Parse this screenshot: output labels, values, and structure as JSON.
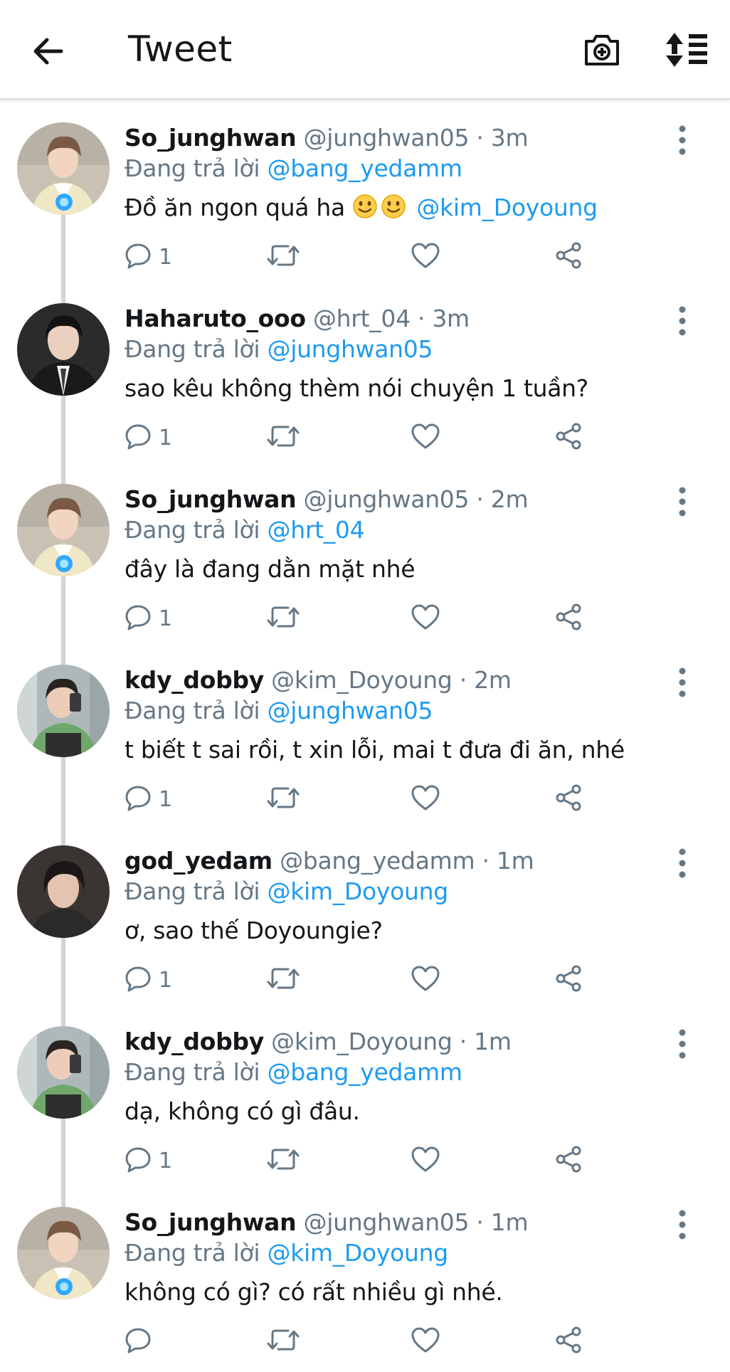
{
  "header": {
    "title": "Tweet"
  },
  "tweets": [
    {
      "name": "So_junghwan",
      "handle": "@junghwan05 · 3m",
      "reply_prefix": "Đang trả lời",
      "reply_to": "@bang_yedamm",
      "text": "Đồ ăn ngon quá ha",
      "mention": "@kim_Doyoung",
      "reply_count": "1",
      "avatar": "junghwan"
    },
    {
      "name": "Haharuto_ooo",
      "handle": "@hrt_04 · 3m",
      "reply_prefix": "Đang trả lời",
      "reply_to": "@junghwan05",
      "text": "sao kêu không thèm nói chuyện 1 tuần?",
      "mention": "",
      "reply_count": "1",
      "avatar": "haruto"
    },
    {
      "name": "So_junghwan",
      "handle": "@junghwan05 · 2m",
      "reply_prefix": "Đang trả lời",
      "reply_to": "@hrt_04",
      "text": "đây là đang dằn mặt nhé",
      "mention": "",
      "reply_count": "1",
      "avatar": "junghwan"
    },
    {
      "name": "kdy_dobby",
      "handle": "@kim_Doyoung · 2m",
      "reply_prefix": "Đang trả lời",
      "reply_to": "@junghwan05",
      "text": "t biết t sai rồi, t xin lỗi, mai t đưa đi ăn, nhé",
      "mention": "",
      "reply_count": "1",
      "avatar": "doyoung"
    },
    {
      "name": "god_yedam",
      "handle": "@bang_yedamm · 1m",
      "reply_prefix": "Đang trả lời",
      "reply_to": "@kim_Doyoung",
      "text": "ơ, sao thế Doyoungie?",
      "mention": "",
      "reply_count": "1",
      "avatar": "yedam"
    },
    {
      "name": "kdy_dobby",
      "handle": "@kim_Doyoung · 1m",
      "reply_prefix": "Đang trả lời",
      "reply_to": "@bang_yedamm",
      "text": "dạ, không có gì đâu.",
      "mention": "",
      "reply_count": "1",
      "avatar": "doyoung"
    },
    {
      "name": "So_junghwan",
      "handle": "@junghwan05 · 1m",
      "reply_prefix": "Đang trả lời",
      "reply_to": "@kim_Doyoung",
      "text": "không có gì? có rất nhiều gì nhé.",
      "mention": "",
      "reply_count": "",
      "avatar": "junghwan"
    }
  ],
  "colors": {
    "link": "#1d9bf0",
    "muted": "#657786",
    "text": "#14171a",
    "thread": "#cfd5da"
  },
  "icons": {
    "back": "arrow-left-icon",
    "camera": "camera-plus-icon",
    "sort": "sort-icon",
    "more": "vertical-dots-icon",
    "reply": "comment-icon",
    "retweet": "retweet-icon",
    "like": "heart-icon",
    "share": "share-icon",
    "emoji": "slightly-smiling-face-emoji"
  }
}
